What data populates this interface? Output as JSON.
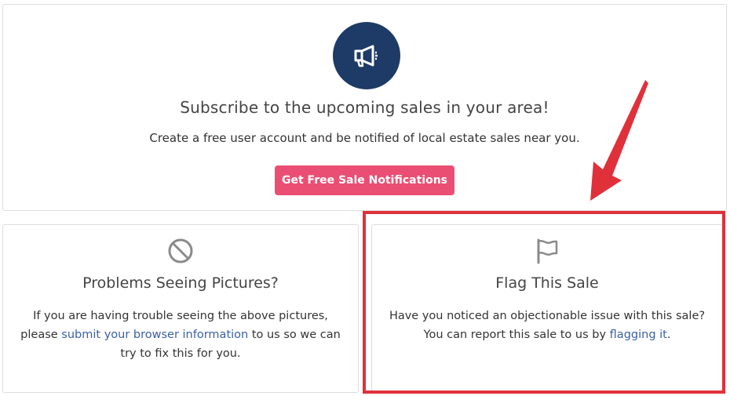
{
  "subscribe": {
    "icon": "megaphone-icon",
    "title": "Subscribe to the upcoming sales in your area!",
    "description": "Create a free user account and be notified of local estate sales near you.",
    "button_label": "Get Free Sale Notifications"
  },
  "problems": {
    "icon": "prohibited-icon",
    "title": "Problems Seeing Pictures?",
    "text_before": "If you are having trouble seeing the above pictures, please",
    "link_text": "submit your browser information",
    "text_after": "to us so we can try to fix this for you."
  },
  "flag": {
    "icon": "flag-icon",
    "title": "Flag This Sale",
    "text_before": "Have you noticed an objectionable issue with this sale? You can report this sale to us by",
    "link_text": "flagging it",
    "text_after": "."
  },
  "colors": {
    "brand_navy": "#1e3a66",
    "cta_pink": "#eb4e73",
    "link_blue": "#3a5fa8",
    "annotation_red": "#e0313b"
  }
}
